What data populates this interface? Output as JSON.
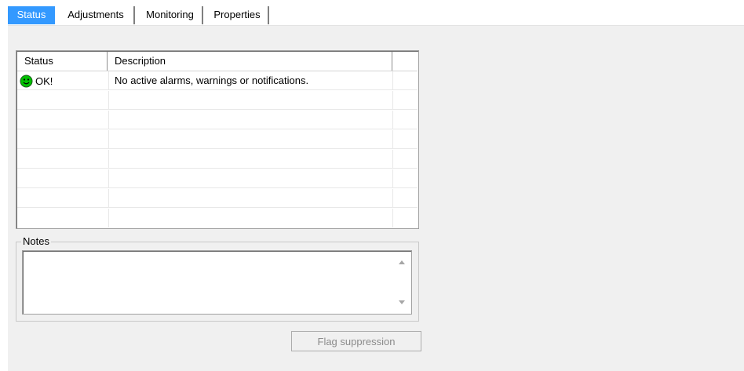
{
  "tabs": [
    {
      "label": "Status",
      "active": true
    },
    {
      "label": "Adjustments",
      "active": false
    },
    {
      "label": "Monitoring",
      "active": false
    },
    {
      "label": "Properties",
      "active": false
    }
  ],
  "status_list": {
    "columns": [
      "Status",
      "Description"
    ],
    "rows": [
      {
        "icon": "smiley-ok-icon",
        "status": "OK!",
        "description": "No active alarms, warnings or notifications."
      }
    ]
  },
  "notes": {
    "label": "Notes",
    "value": ""
  },
  "flag_suppression_button": {
    "label": "Flag suppression",
    "enabled": false
  },
  "colors": {
    "active_tab": "#3399ff",
    "smiley": "#00c000"
  }
}
